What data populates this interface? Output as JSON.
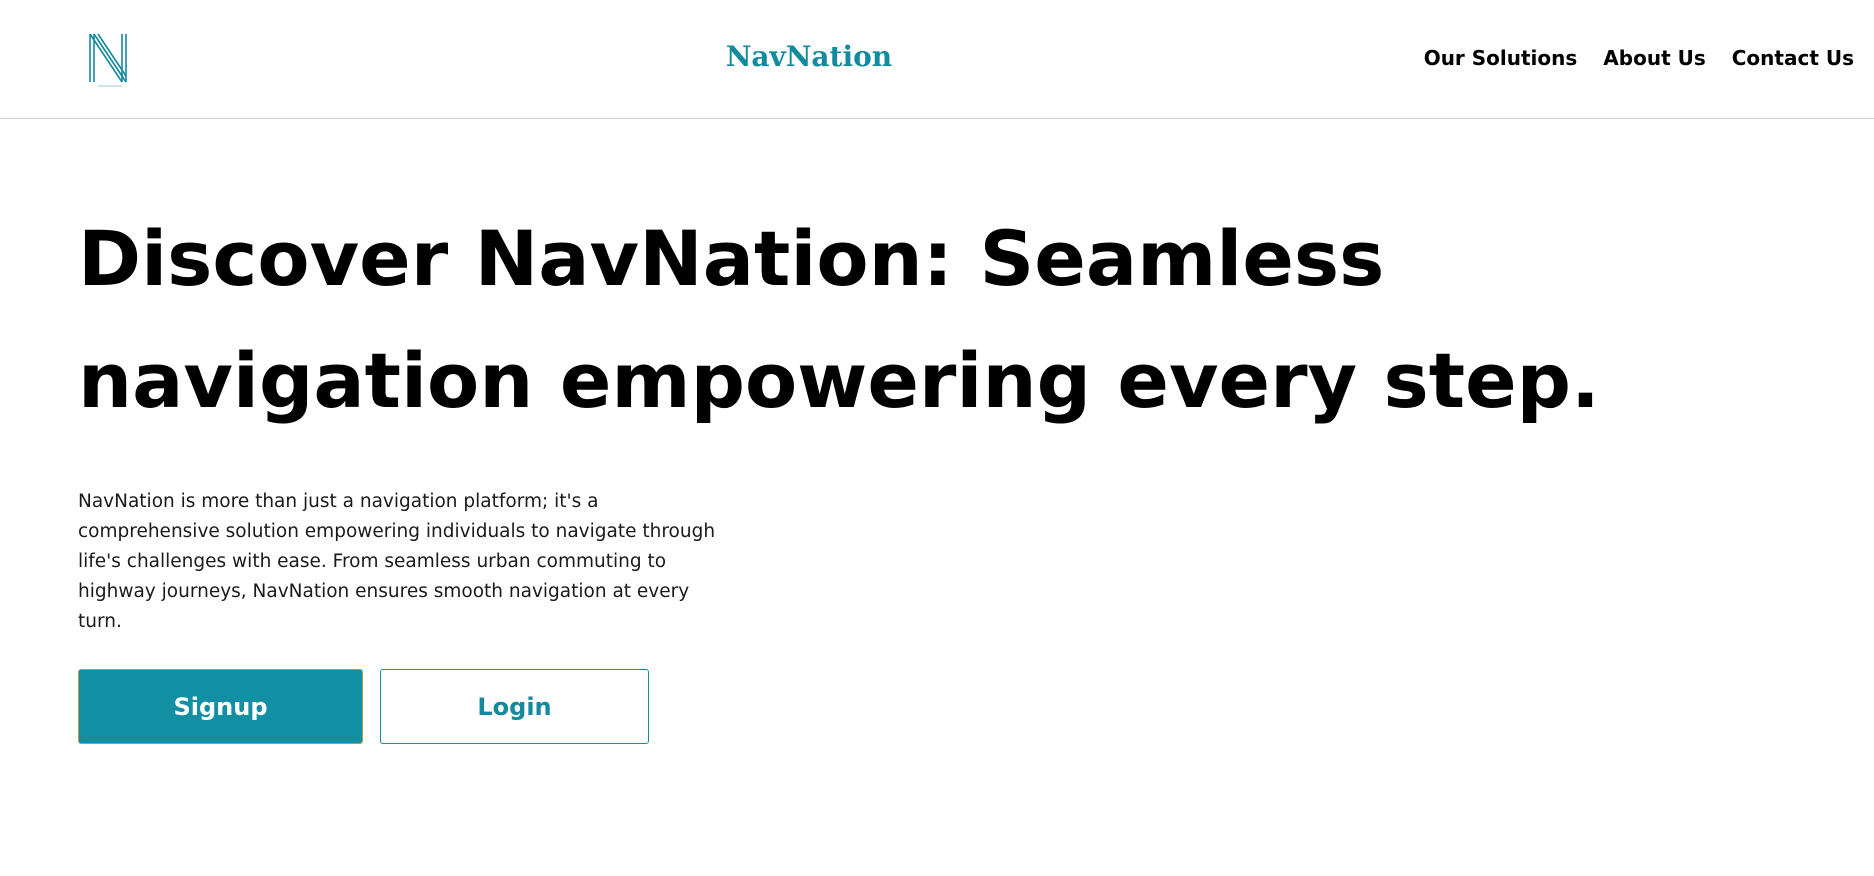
{
  "colors": {
    "brand": "#138a9e",
    "primary_button": "#138fa3",
    "text": "#000000"
  },
  "header": {
    "logo_icon": "navnation-n-logo-icon",
    "brand_name": "NavNation",
    "nav": [
      {
        "label": "Our Solutions"
      },
      {
        "label": "About Us"
      },
      {
        "label": "Contact Us"
      }
    ]
  },
  "hero": {
    "title": "Discover NavNation: Seamless navigation empowering every step.",
    "description": "NavNation is more than just a navigation platform; it's a comprehensive solution empowering individuals to navigate through life's challenges with ease. From seamless urban commuting to highway journeys, NavNation ensures smooth navigation at every turn.",
    "signup_label": "Signup",
    "login_label": "Login"
  }
}
